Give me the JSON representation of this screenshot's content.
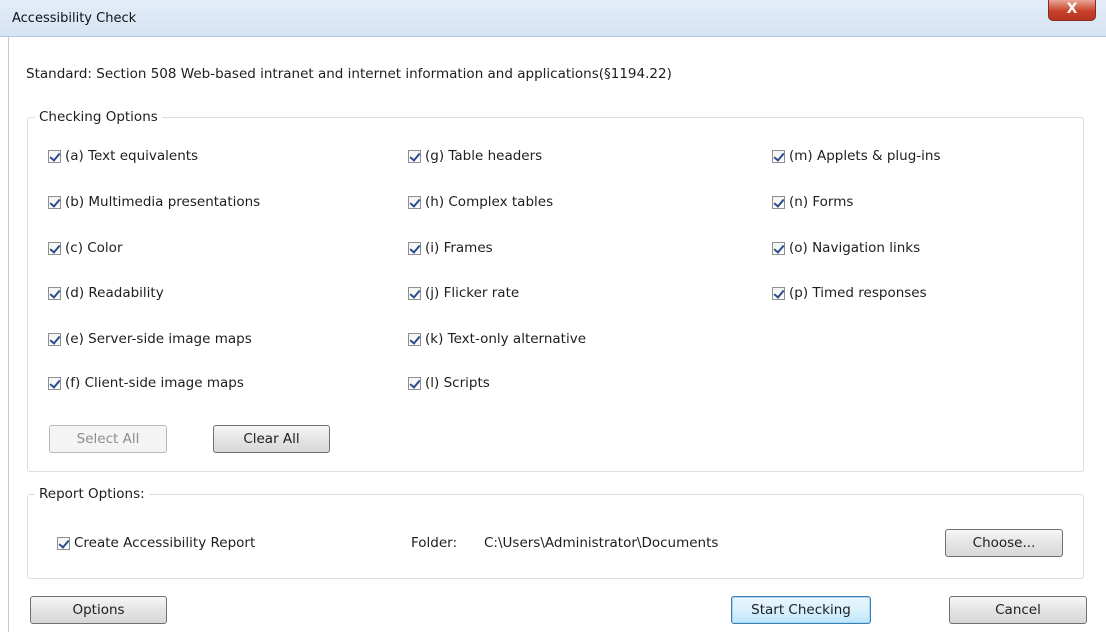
{
  "window": {
    "title": "Accessibility Check",
    "close_label": "X"
  },
  "standard": {
    "text": "Standard: Section 508 Web-based intranet and internet information and applications(§1194.22)"
  },
  "checking_options": {
    "legend": "Checking Options",
    "items": [
      {
        "label": "(a) Text equivalents",
        "checked": true
      },
      {
        "label": "(b) Multimedia presentations",
        "checked": true
      },
      {
        "label": "(c) Color",
        "checked": true
      },
      {
        "label": "(d) Readability",
        "checked": true
      },
      {
        "label": "(e) Server-side image maps",
        "checked": true
      },
      {
        "label": "(f) Client-side image maps",
        "checked": true
      },
      {
        "label": "(g) Table headers",
        "checked": true
      },
      {
        "label": "(h) Complex tables",
        "checked": true
      },
      {
        "label": "(i) Frames",
        "checked": true
      },
      {
        "label": "(j) Flicker rate",
        "checked": true
      },
      {
        "label": "(k) Text-only alternative",
        "checked": true
      },
      {
        "label": "(l) Scripts",
        "checked": true
      },
      {
        "label": "(m) Applets & plug-ins",
        "checked": true
      },
      {
        "label": "(n) Forms",
        "checked": true
      },
      {
        "label": "(o) Navigation links",
        "checked": true
      },
      {
        "label": "(p) Timed responses",
        "checked": true
      }
    ],
    "select_all_label": "Select All",
    "select_all_enabled": false,
    "clear_all_label": "Clear All"
  },
  "report_options": {
    "legend": "Report Options:",
    "create_report_label": "Create Accessibility Report",
    "create_report_checked": true,
    "folder_label": "Folder:",
    "folder_path": "C:\\Users\\Administrator\\Documents",
    "choose_label": "Choose..."
  },
  "footer": {
    "options_label": "Options",
    "start_label": "Start Checking",
    "cancel_label": "Cancel"
  },
  "colors": {
    "titlebar": "#d6e3f3",
    "close_button": "#c8422b",
    "group_border": "#d5dfe5",
    "checkmark": "#2b4d8c",
    "primary_button_border": "#3c7fb1"
  }
}
